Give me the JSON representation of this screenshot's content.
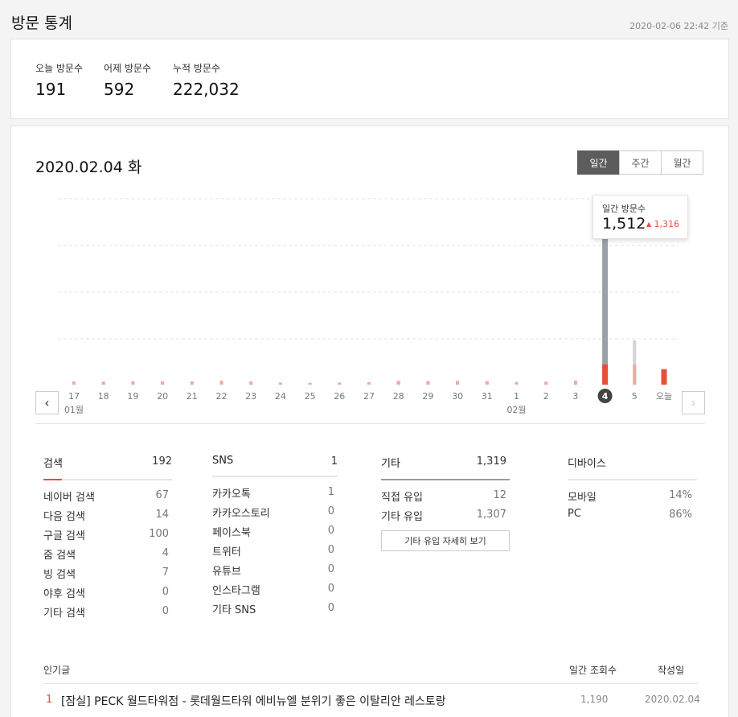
{
  "header": {
    "title": "방문 통계",
    "timestamp": "2020-02-06 22:42 기준"
  },
  "summary": [
    {
      "label": "오늘 방문수",
      "value": "191"
    },
    {
      "label": "어제 방문수",
      "value": "592"
    },
    {
      "label": "누적 방문수",
      "value": "222,032"
    }
  ],
  "chart_section": {
    "date_title": "2020.02.04 화",
    "tabs": [
      "일간",
      "주간",
      "월간"
    ],
    "active_tab": "일간",
    "tooltip": {
      "label": "일간 방문수",
      "value": "1,512",
      "delta": "1,316",
      "delta_arrow": "▲"
    },
    "nav_prev": "‹",
    "nav_next": "›",
    "month_labels": [
      {
        "text": "01월",
        "under_index": 0
      },
      {
        "text": "02월",
        "under_index": 15
      }
    ]
  },
  "colors": {
    "accent": "#e6503b",
    "bar_gray": "#9aa1a8",
    "bar_pink": "#f4a7a0",
    "active_tab": "#5c5c5c"
  },
  "chart_data": {
    "type": "bar",
    "x": [
      "17",
      "18",
      "19",
      "20",
      "21",
      "22",
      "23",
      "24",
      "25",
      "26",
      "27",
      "28",
      "29",
      "30",
      "31",
      "1",
      "2",
      "3",
      "4",
      "5",
      "오늘"
    ],
    "selected": "4",
    "series": [
      {
        "values": [
          32,
          30,
          34,
          33,
          32,
          40,
          30,
          22,
          18,
          20,
          25,
          38,
          35,
          37,
          35,
          27,
          29,
          41,
          1512,
          430,
          40
        ]
      },
      {
        "values": [
          28,
          26,
          30,
          30,
          30,
          34,
          28,
          18,
          16,
          18,
          22,
          34,
          32,
          34,
          33,
          24,
          26,
          36,
          196,
          196,
          150
        ]
      }
    ],
    "ylim": [
      0,
      1800
    ],
    "grid": true
  },
  "sources": {
    "search": {
      "title": "검색",
      "total": "192",
      "rows": [
        {
          "label": "네이버 검색",
          "value": "67"
        },
        {
          "label": "다음 검색",
          "value": "14"
        },
        {
          "label": "구글 검색",
          "value": "100"
        },
        {
          "label": "줌 검색",
          "value": "4"
        },
        {
          "label": "빙 검색",
          "value": "7"
        },
        {
          "label": "야후 검색",
          "value": "0"
        },
        {
          "label": "기타 검색",
          "value": "0"
        }
      ]
    },
    "sns": {
      "title": "SNS",
      "total": "1",
      "rows": [
        {
          "label": "카카오톡",
          "value": "1"
        },
        {
          "label": "카카오스토리",
          "value": "0"
        },
        {
          "label": "페이스북",
          "value": "0"
        },
        {
          "label": "트위터",
          "value": "0"
        },
        {
          "label": "유튜브",
          "value": "0"
        },
        {
          "label": "인스타그램",
          "value": "0"
        },
        {
          "label": "기타 SNS",
          "value": "0"
        }
      ]
    },
    "etc": {
      "title": "기타",
      "total": "1,319",
      "rows": [
        {
          "label": "직접 유입",
          "value": "12"
        },
        {
          "label": "기타 유입",
          "value": "1,307"
        }
      ],
      "more_button": "기타 유입 자세히 보기"
    },
    "device": {
      "title": "디바이스",
      "rows": [
        {
          "label": "모바일",
          "value": "14%"
        },
        {
          "label": "PC",
          "value": "86%"
        }
      ]
    }
  },
  "popular": {
    "headers": {
      "title": "인기글",
      "views": "일간 조회수",
      "date": "작성일"
    },
    "rows": [
      {
        "rank": "1",
        "title": "[잠실] PECK 월드타워점 - 롯데월드타워 에비뉴엘 분위기 좋은 이탈리안 레스토랑",
        "views": "1,190",
        "date": "2020.02.04"
      }
    ]
  }
}
